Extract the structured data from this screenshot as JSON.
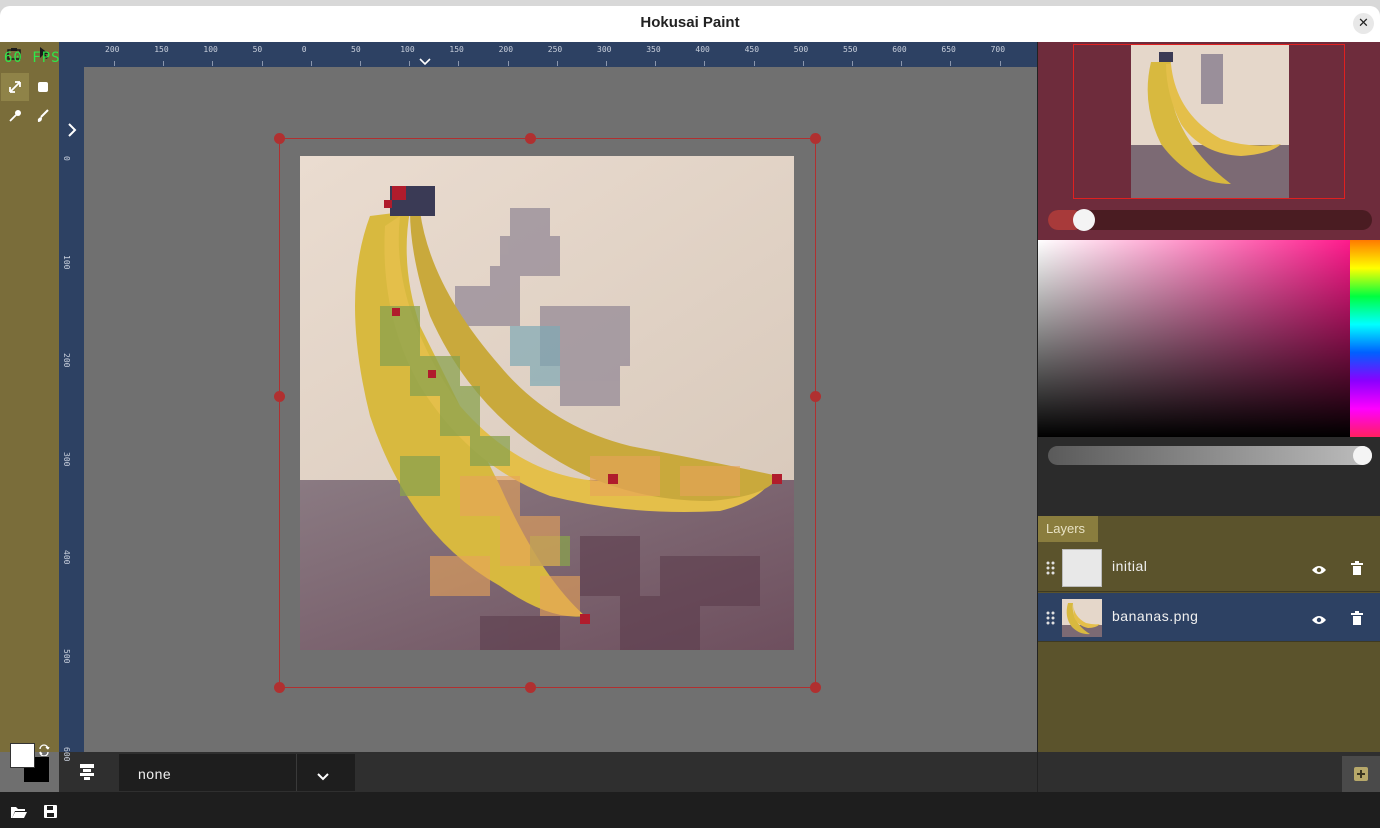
{
  "window": {
    "title": "Hokusai Paint",
    "close_icon": "close-icon"
  },
  "fps_text": "60 FPS",
  "toolbar": {
    "tools": [
      {
        "name": "move-tool",
        "icon": "move-icon",
        "active": true
      },
      {
        "name": "select-tool",
        "icon": "square-icon",
        "active": false
      },
      {
        "name": "eyedropper-tool",
        "icon": "eyedropper-icon",
        "active": false
      },
      {
        "name": "brush-tool",
        "icon": "brush-icon",
        "active": false
      }
    ],
    "foreground_color": "#ffffff",
    "background_color": "#000000"
  },
  "rulers": {
    "top_labels": [
      "200",
      "150",
      "100",
      "50",
      "0",
      "50",
      "100",
      "150",
      "200",
      "250",
      "300",
      "350",
      "400",
      "450",
      "500",
      "550",
      "600",
      "650",
      "700"
    ],
    "left_labels": [
      "0",
      "100",
      "200",
      "300",
      "400",
      "500",
      "600"
    ]
  },
  "canvas": {
    "image": "bananas-painting"
  },
  "color_picker": {
    "hue": "#ff1a8c",
    "opacity_percent": 100
  },
  "layers": {
    "tab_label": "Layers",
    "items": [
      {
        "name": "initial",
        "selected": false,
        "visible": true
      },
      {
        "name": "bananas.png",
        "selected": true,
        "visible": true
      }
    ],
    "add_icon": "add-layer-icon"
  },
  "bottombar": {
    "blend_mode": "none"
  },
  "statusbar": {
    "open_icon": "folder-open-icon",
    "save_icon": "save-icon"
  },
  "colors": {
    "toolbar": "#7a6d3a",
    "ruler": "#2d4163",
    "preview_bg": "#6e2c3c",
    "layer_selected": "#2d4163",
    "handle": "#b03030"
  }
}
